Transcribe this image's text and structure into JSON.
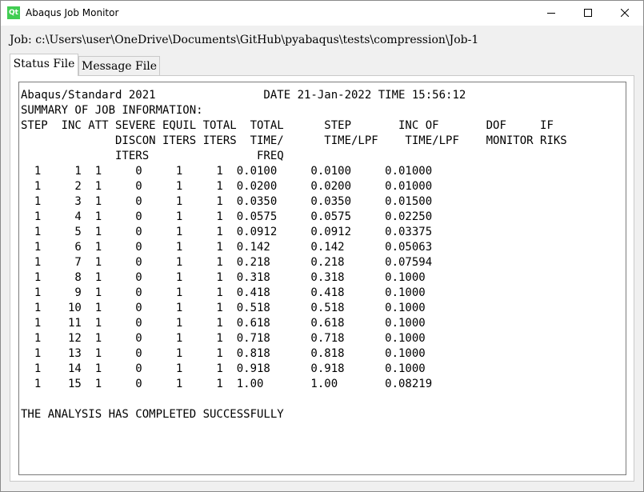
{
  "window": {
    "app_icon_text": "Qt",
    "title": "Abaqus Job Monitor",
    "controls": [
      "minimize",
      "maximize",
      "close"
    ]
  },
  "job": {
    "label": "Job:",
    "path": "c:\\Users\\user\\OneDrive\\Documents\\GitHub\\pyabaqus\\tests\\compression\\Job-1"
  },
  "tabs": [
    {
      "label": "Status File",
      "active": true
    },
    {
      "label": "Message File",
      "active": false
    }
  ],
  "status_file": {
    "lines": [
      "Abaqus/Standard 2021                DATE 21-Jan-2022 TIME 15:56:12",
      "SUMMARY OF JOB INFORMATION:",
      "STEP  INC ATT SEVERE EQUIL TOTAL  TOTAL      STEP       INC OF       DOF     IF",
      "              DISCON ITERS ITERS  TIME/      TIME/LPF    TIME/LPF    MONITOR RIKS",
      "              ITERS                FREQ",
      "  1     1  1     0     1     1  0.0100     0.0100     0.01000",
      "  1     2  1     0     1     1  0.0200     0.0200     0.01000",
      "  1     3  1     0     1     1  0.0350     0.0350     0.01500",
      "  1     4  1     0     1     1  0.0575     0.0575     0.02250",
      "  1     5  1     0     1     1  0.0912     0.0912     0.03375",
      "  1     6  1     0     1     1  0.142      0.142      0.05063",
      "  1     7  1     0     1     1  0.218      0.218      0.07594",
      "  1     8  1     0     1     1  0.318      0.318      0.1000",
      "  1     9  1     0     1     1  0.418      0.418      0.1000",
      "  1    10  1     0     1     1  0.518      0.518      0.1000",
      "  1    11  1     0     1     1  0.618      0.618      0.1000",
      "  1    12  1     0     1     1  0.718      0.718      0.1000",
      "  1    13  1     0     1     1  0.818      0.818      0.1000",
      "  1    14  1     0     1     1  0.918      0.918      0.1000",
      "  1    15  1     0     1     1  1.00       1.00       0.08219",
      "",
      "THE ANALYSIS HAS COMPLETED SUCCESSFULLY"
    ]
  }
}
